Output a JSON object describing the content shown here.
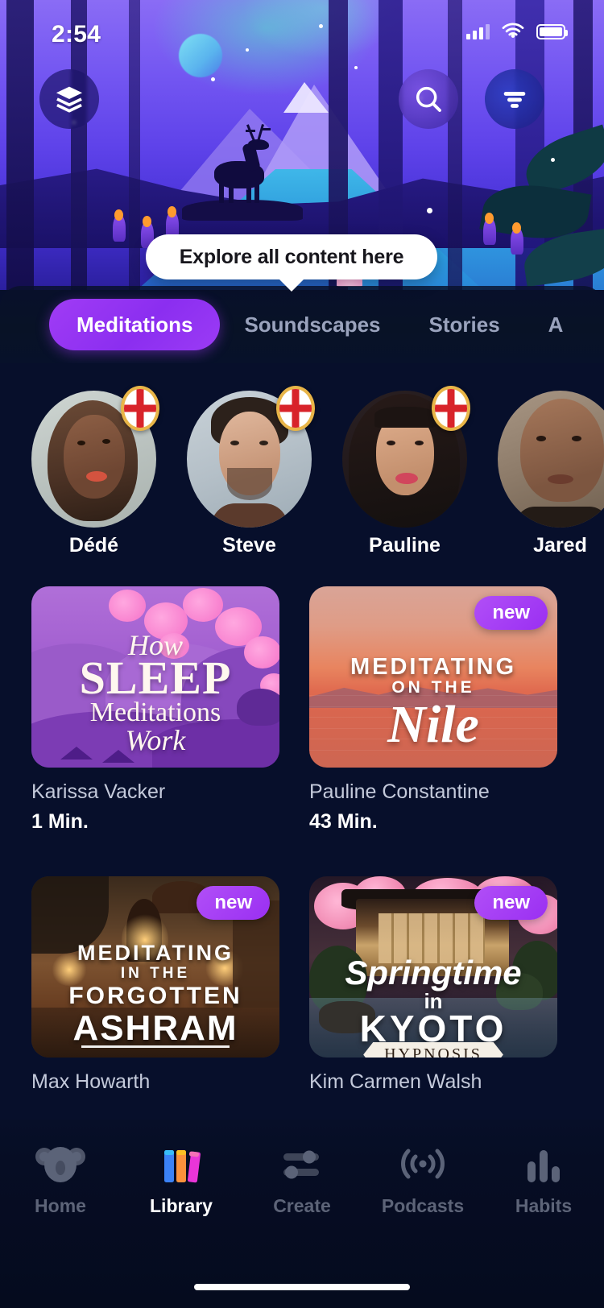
{
  "status_bar": {
    "time": "2:54",
    "signal_icon": "cellular-signal-icon",
    "wifi_icon": "wifi-icon",
    "battery_icon": "battery-icon"
  },
  "header": {
    "layers_button": "layers-icon",
    "search_button": "search-icon",
    "filter_button": "filter-icon"
  },
  "tooltip": {
    "text": "Explore all content here"
  },
  "tabs": [
    {
      "label": "Meditations",
      "active": true
    },
    {
      "label": "Soundscapes",
      "active": false
    },
    {
      "label": "Stories",
      "active": false
    },
    {
      "label": "A",
      "active": false
    }
  ],
  "teachers": [
    {
      "name": "Dédé",
      "badge": "england-flag-badge"
    },
    {
      "name": "Steve",
      "badge": "england-flag-badge"
    },
    {
      "name": "Pauline",
      "badge": "england-flag-badge"
    },
    {
      "name": "Jared",
      "badge": "england-flag-badge"
    }
  ],
  "cards": [
    {
      "title_lines": [
        "How",
        "SLEEP",
        "Meditations",
        "Work"
      ],
      "author": "Karissa Vacker",
      "duration": "1 Min.",
      "new_badge": null
    },
    {
      "title_lines": [
        "MEDITATING",
        "ON THE",
        "Nile"
      ],
      "author": "Pauline Constantine",
      "duration": "43 Min.",
      "new_badge": "new"
    },
    {
      "title_lines": [
        "MEDITATING",
        "IN THE",
        "FORGOTTEN",
        "ASHRAM"
      ],
      "author": "Max Howarth",
      "duration": "",
      "new_badge": "new"
    },
    {
      "title_lines": [
        "Springtime",
        "in",
        "KYOTO",
        "HYPNOSIS"
      ],
      "author": "Kim Carmen Walsh",
      "duration": "",
      "new_badge": "new"
    }
  ],
  "bottom_nav": [
    {
      "label": "Home",
      "icon": "koala-icon",
      "active": false
    },
    {
      "label": "Library",
      "icon": "books-icon",
      "active": true
    },
    {
      "label": "Create",
      "icon": "sliders-icon",
      "active": false
    },
    {
      "label": "Podcasts",
      "icon": "broadcast-icon",
      "active": false
    },
    {
      "label": "Habits",
      "icon": "bar-chart-icon",
      "active": false
    }
  ],
  "colors": {
    "accent_purple": "#9a2ff2",
    "background": "#070f2b",
    "tooltip_bg": "#ffffff",
    "nav_inactive": "#5d6478",
    "badge_gold": "#e8b548",
    "flag_red": "#d8232a"
  }
}
